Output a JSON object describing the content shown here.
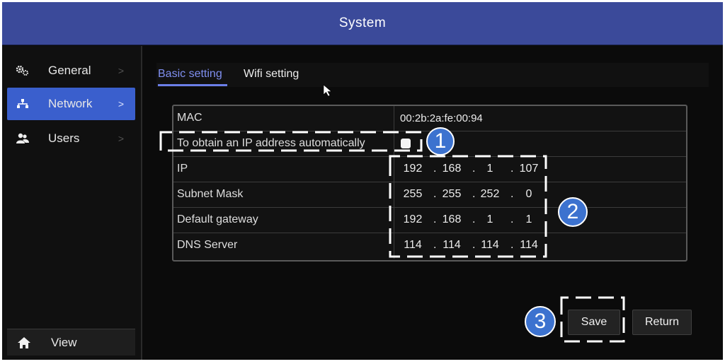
{
  "window": {
    "title": "System"
  },
  "sidebar": {
    "items": [
      {
        "label": "General",
        "icon": "gears-icon",
        "chevron": ">"
      },
      {
        "label": "Network",
        "icon": "network-icon",
        "chevron": ">",
        "active": true
      },
      {
        "label": "Users",
        "icon": "users-icon",
        "chevron": ">"
      }
    ],
    "view": {
      "label": "View",
      "icon": "home-icon"
    }
  },
  "tabs": [
    {
      "label": "Basic setting",
      "active": true
    },
    {
      "label": "Wifi setting",
      "active": false
    }
  ],
  "settings": {
    "mac": {
      "label": "MAC",
      "value": "00:2b:2a:fe:00:94"
    },
    "auto_ip": {
      "label": "To obtain an IP address automatically",
      "checked": false
    },
    "ip": {
      "label": "IP",
      "octets": [
        "192",
        "168",
        "1",
        "107"
      ]
    },
    "subnet": {
      "label": "Subnet Mask",
      "octets": [
        "255",
        "255",
        "252",
        "0"
      ]
    },
    "gateway": {
      "label": "Default gateway",
      "octets": [
        "192",
        "168",
        "1",
        "1"
      ]
    },
    "dns": {
      "label": "DNS Server",
      "octets": [
        "114",
        "114",
        "114",
        "114"
      ]
    }
  },
  "actions": {
    "save_label": "Save",
    "return_label": "Return"
  },
  "callouts": [
    "1",
    "2",
    "3"
  ],
  "colors": {
    "title_bar": "#3b4a9a",
    "active_item": "#3a5fcd",
    "active_tab": "#7f8ff0",
    "callout": "#3c72cf"
  }
}
